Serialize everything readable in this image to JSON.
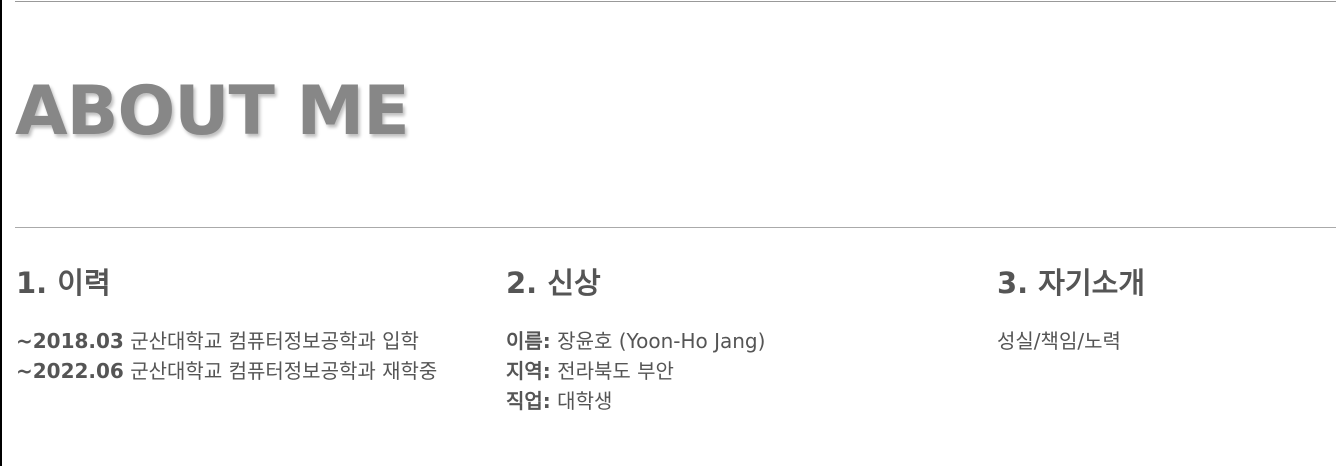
{
  "hero": {
    "title": "ABOUT ME"
  },
  "sections": [
    {
      "heading": "1. 이력",
      "lines": [
        {
          "label": "~2018.03",
          "text": " 군산대학교 컴퓨터정보공학과 입학"
        },
        {
          "label": "~2022.06",
          "text": " 군산대학교 컴퓨터정보공학과 재학중"
        }
      ]
    },
    {
      "heading": "2. 신상",
      "lines": [
        {
          "label": "이름:",
          "text": " 장윤호 (Yoon-Ho Jang)"
        },
        {
          "label": "지역:",
          "text": " 전라북도 부안"
        },
        {
          "label": "직업:",
          "text": " 대학생"
        }
      ]
    },
    {
      "heading": "3. 자기소개",
      "lines": [
        {
          "text": "성실/책임/노력"
        }
      ]
    }
  ],
  "colors": {
    "title": "#878787",
    "body_text": "#555555",
    "rule": "#aaaaaa",
    "left_border": "#000000"
  }
}
